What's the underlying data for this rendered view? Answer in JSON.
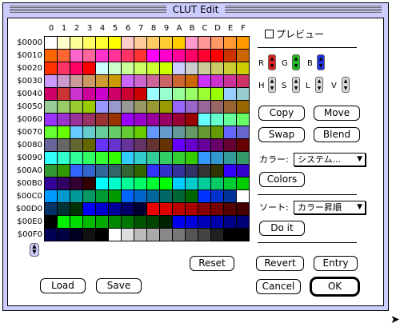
{
  "window": {
    "title": "CLUT Edit"
  },
  "clut": {
    "column_headers": [
      "0",
      "1",
      "2",
      "3",
      "4",
      "5",
      "6",
      "7",
      "8",
      "9",
      "A",
      "B",
      "C",
      "D",
      "E",
      "F"
    ],
    "row_headers": [
      "$0000",
      "$0010",
      "$0020",
      "$0030",
      "$0040",
      "$0050",
      "$0060",
      "$0070",
      "$0080",
      "$0090",
      "$00A0",
      "$00B0",
      "$00C0",
      "$00D0",
      "$00E0",
      "$00F0"
    ],
    "rows": [
      [
        "#ffffff",
        "#ffffcc",
        "#ffff99",
        "#ffff66",
        "#ffff33",
        "#ffff00",
        "#ffcccc",
        "#ffcc99",
        "#ffcc66",
        "#ffcc33",
        "#ffcc00",
        "#ff99cc",
        "#ff9999",
        "#ff9966",
        "#ff9933",
        "#ff9900"
      ],
      [
        "#ff6600",
        "#ff6633",
        "#ff66cc",
        "#ff6699",
        "#ff33cc",
        "#ff3399",
        "#ff3366",
        "#ff3333",
        "#ff00ff",
        "#ff00cc",
        "#ff0099",
        "#ff0066",
        "#ff0033",
        "#ff0000",
        "#cc3300",
        "#cc6600"
      ],
      [
        "#ff3300",
        "#ff3366",
        "#ff0066",
        "#ff0000",
        "#ccffff",
        "#ccffcc",
        "#ccff99",
        "#ccff66",
        "#ccff33",
        "#ccff00",
        "#ccccff",
        "#cccccc",
        "#cccc99",
        "#cccc66",
        "#cccc33",
        "#cccc00"
      ],
      [
        "#cc99ff",
        "#cc99cc",
        "#cc9999",
        "#cc9966",
        "#cc9933",
        "#cc9900",
        "#cc66ff",
        "#cc66cc",
        "#cc6699",
        "#cc6666",
        "#cc6633",
        "#cc6600",
        "#cc33ff",
        "#cc33cc",
        "#cc3399",
        "#cc3366"
      ],
      [
        "#cc0066",
        "#cc3333",
        "#cc33cc",
        "#cc0099",
        "#cc00cc",
        "#cc0066",
        "#cc0033",
        "#cc0000",
        "#99ffff",
        "#99ffcc",
        "#99ff99",
        "#99ff66",
        "#99ff33",
        "#99ff00",
        "#99ccff",
        "#99cccc"
      ],
      [
        "#99cc99",
        "#99cc66",
        "#99cc33",
        "#99cc00",
        "#9999ff",
        "#9999cc",
        "#999999",
        "#999966",
        "#999933",
        "#999900",
        "#9966ff",
        "#9966cc",
        "#996699",
        "#996666",
        "#996633",
        "#996600"
      ],
      [
        "#9933ff",
        "#9933cc",
        "#993399",
        "#993366",
        "#993333",
        "#993300",
        "#9900ff",
        "#9900cc",
        "#990099",
        "#990066",
        "#990033",
        "#990000",
        "#66ffff",
        "#66ffcc",
        "#66ff99",
        "#66ff66"
      ],
      [
        "#66ff33",
        "#66ff00",
        "#66ccff",
        "#66cccc",
        "#66cc99",
        "#66cc66",
        "#66cc33",
        "#66cc00",
        "#6699ff",
        "#6699cc",
        "#669999",
        "#669966",
        "#669933",
        "#669900",
        "#6666ff",
        "#6666cc"
      ],
      [
        "#666699",
        "#666666",
        "#666633",
        "#666600",
        "#6633ff",
        "#6633cc",
        "#663399",
        "#663366",
        "#663333",
        "#663300",
        "#6600ff",
        "#6600cc",
        "#660099",
        "#660066",
        "#660033",
        "#660000"
      ],
      [
        "#33ffff",
        "#33ffcc",
        "#33ff99",
        "#33ff66",
        "#33ff33",
        "#33ff00",
        "#33ccff",
        "#33cccc",
        "#33cc99",
        "#33cc66",
        "#33cc33",
        "#33cc00",
        "#3399ff",
        "#3399cc",
        "#339999",
        "#339966"
      ],
      [
        "#339933",
        "#339900",
        "#3366ff",
        "#3366cc",
        "#336699",
        "#336666",
        "#336633",
        "#336600",
        "#3333ff",
        "#3333cc",
        "#333399",
        "#333366",
        "#333333",
        "#333300",
        "#3300ff",
        "#3300cc"
      ],
      [
        "#330099",
        "#330066",
        "#330033",
        "#330000",
        "#00ffff",
        "#00ffcc",
        "#00ff99",
        "#00ff66",
        "#00ff33",
        "#00ff00",
        "#00ccff",
        "#00cccc",
        "#00cc99",
        "#00cc66",
        "#00cc33",
        "#00cc00"
      ],
      [
        "#0099ff",
        "#0099cc",
        "#009999",
        "#009966",
        "#009933",
        "#009900",
        "#0066ff",
        "#0066cc",
        "#006699",
        "#006666",
        "#006633",
        "#006600",
        "#0033ff",
        "#0033cc",
        "#003399",
        "#ffffff"
      ],
      [
        "#003366",
        "#003333",
        "#003300",
        "#0000ff",
        "#0000cc",
        "#000099",
        "#000066",
        "#000033",
        "#ee0000",
        "#dd0000",
        "#bb0000",
        "#aa0000",
        "#880000",
        "#770000",
        "#550000",
        "#440000"
      ],
      [
        "#000000",
        "#00ee00",
        "#00dd00",
        "#00bb00",
        "#00aa00",
        "#008800",
        "#007700",
        "#005500",
        "#004400",
        "#002200",
        "#0000ee",
        "#0000dd",
        "#0000bb",
        "#0000aa",
        "#000088",
        "#000077"
      ],
      [
        "#000055",
        "#000044",
        "#000022",
        "#111111",
        "#000000",
        "#ffffff",
        "#dddddd",
        "#bbbbbb",
        "#aaaaaa",
        "#888888",
        "#777777",
        "#555555",
        "#444444",
        "#222222",
        "#000000",
        "#000000"
      ]
    ]
  },
  "preview": {
    "label": "プレビュー",
    "checked": false
  },
  "channels": {
    "r": "R",
    "g": "G",
    "b": "B",
    "h": "H",
    "s": "S",
    "l": "L",
    "v": "V"
  },
  "buttons": {
    "copy": "Copy",
    "move": "Move",
    "swap": "Swap",
    "blend": "Blend",
    "colors": "Colors",
    "do_it": "Do it",
    "reset": "Reset",
    "revert": "Revert",
    "entry": "Entry",
    "load": "Load",
    "save": "Save",
    "cancel": "Cancel",
    "ok": "OK"
  },
  "color_popup": {
    "label": "カラー:",
    "value": "システム..."
  },
  "sort_popup": {
    "label": "ソート:",
    "value": "カラー昇順"
  },
  "scroll_arrows": {
    "up": "▲",
    "down": "▼"
  }
}
